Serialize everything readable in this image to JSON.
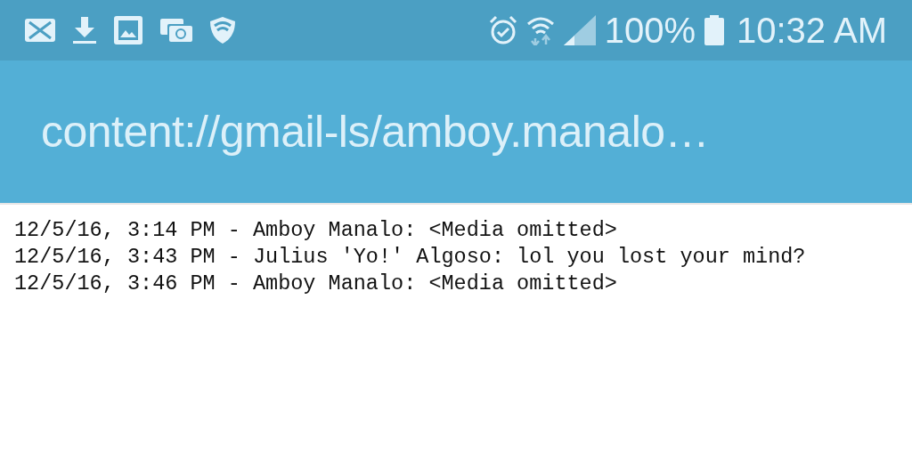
{
  "status_bar": {
    "battery": "100%",
    "time": "10:32 AM"
  },
  "app_bar": {
    "title": "content://gmail-ls/amboy.manalo…"
  },
  "lines": [
    "12/5/16, 3:14 PM - Amboy Manalo: <Media omitted>",
    "12/5/16, 3:43 PM - Julius 'Yo!' Algoso: lol you lost your mind?",
    "12/5/16, 3:46 PM - Amboy Manalo: <Media omitted>"
  ]
}
